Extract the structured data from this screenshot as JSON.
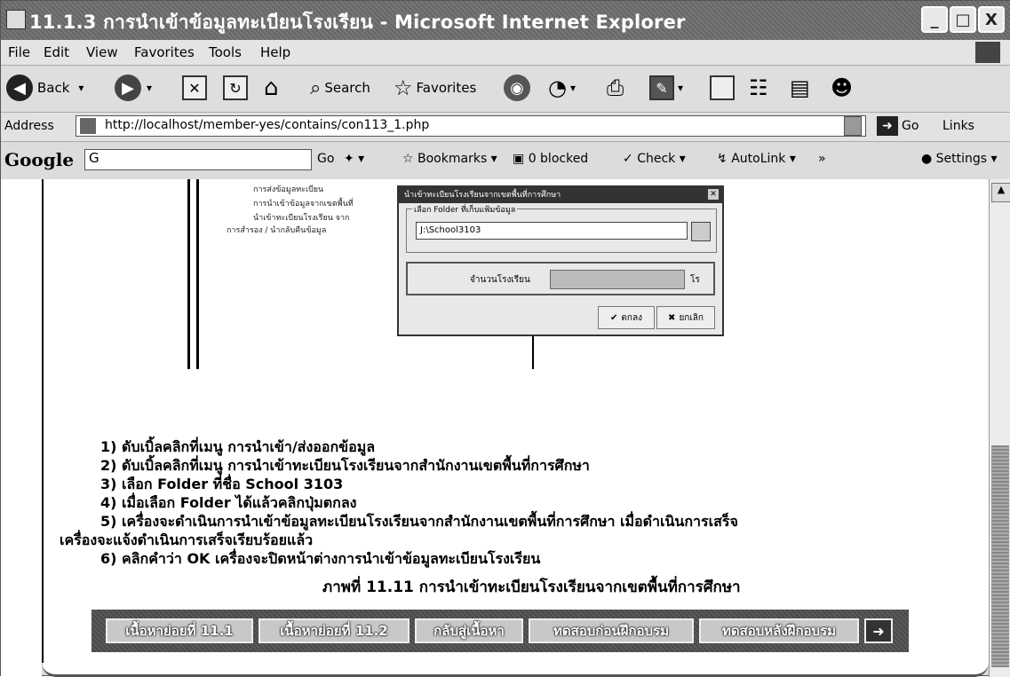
{
  "window": {
    "title": "11.1.3 การนำเข้าข้อมูลทะเบียนโรงเรียน - Microsoft Internet Explorer",
    "minimize": "_",
    "maximize": "□",
    "close": "X"
  },
  "menu": [
    "File",
    "Edit",
    "View",
    "Favorites",
    "Tools",
    "Help"
  ],
  "toolbar": {
    "back": "Back",
    "search": "Search",
    "favorites": "Favorites"
  },
  "address": {
    "label": "Address",
    "url": "http://localhost/member-yes/contains/con113_1.php",
    "go": "Go",
    "links": "Links"
  },
  "google_bar": {
    "logo": "Google",
    "input": "G",
    "go": "Go",
    "bookmarks": "Bookmarks",
    "blocked": "0 blocked",
    "check": "Check",
    "autolink": "AutoLink",
    "settings": "Settings"
  },
  "figure": {
    "tree_items": [
      "การส่งข้อมูลทะเบียน",
      "การนำเข้าข้อมูลจากเขตพื้นที่",
      "นำเข้าทะเบียนโรงเรียน จาก",
      "การสำรอง / นำกลับคืนข้อมูล"
    ],
    "dialog": {
      "title": "นำเข้าทะเบียนโรงเรียนจากเขตพื้นที่การศึกษา",
      "group_label": "เลือก Folder ที่เก็บแฟ้มข้อมูล",
      "path": "J:\\School3103",
      "count_label": "จำนวนโรงเรียน",
      "count_unit": "โร",
      "ok": "ตกลง",
      "cancel": "ยกเลิก"
    },
    "caption": "ภาพที่ 11.11 การนำเข้าทะเบียนโรงเรียนจากเขตพื้นที่การศึกษา"
  },
  "steps": [
    "1) ดับเบิ้ลคลิกที่เมนู การนำเข้า/ส่งออกข้อมูล",
    "2) ดับเบิ้ลคลิกที่เมนู การนำเข้าทะเบียนโรงเรียนจากสำนักงานเขตพื้นที่การศึกษา",
    "3) เลือก Folder ที่ชื่อ School 3103",
    "4) เมื่อเลือก Folder ได้แล้วคลิกปุ่มตกลง",
    "5) เครื่องจะดำเนินการนำเข้าข้อมูลทะเบียนโรงเรียนจากสำนักงานเขตพื้นที่การศึกษา เมื่อดำเนินการเสร็จ",
    "เครื่องจะแจ้งดำเนินการเสร็จเรียบร้อยแล้ว",
    "6) คลิกคำว่า OK เครื่องจะปิดหน้าต่างการนำเข้าข้อมูลทะเบียนโรงเรียน"
  ],
  "nav": {
    "btn1": "เนื้อหาย่อยที่ 11.1",
    "btn2": "เนื้อหาย่อยที่ 11.2",
    "btn3": "กลับสู่เนื้อหา",
    "btn4": "ทดสอบก่อนฝึกอบรม",
    "btn5": "ทดสอบหลังฝึกอบรม",
    "next": "➜"
  }
}
